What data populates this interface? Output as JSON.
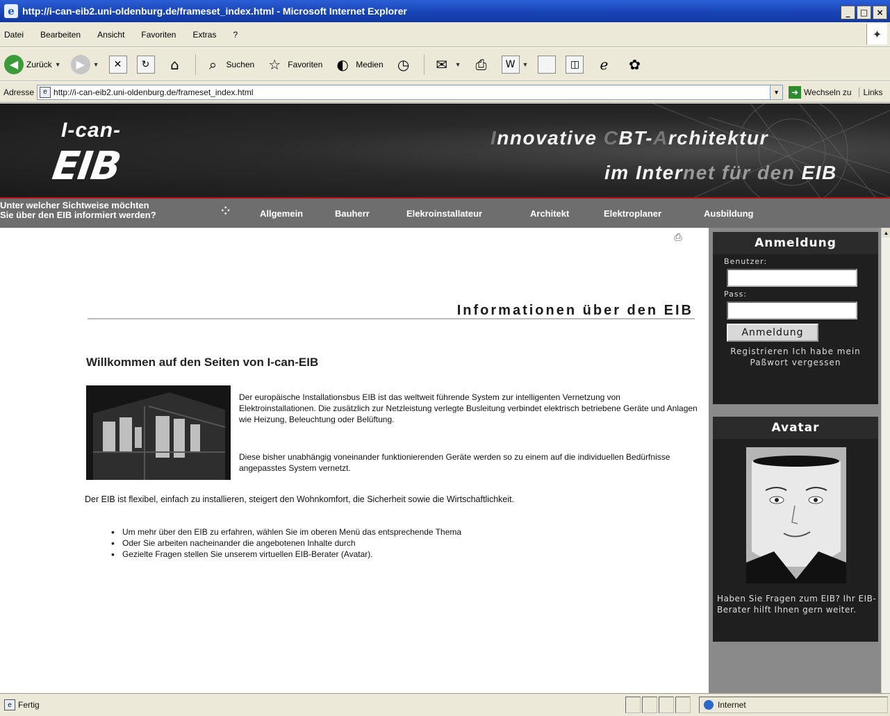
{
  "window": {
    "title": "http://i-can-eib2.uni-oldenburg.de/frameset_index.html - Microsoft Internet Explorer",
    "controls": [
      "_",
      "□",
      "×"
    ]
  },
  "menu": [
    "Datei",
    "Bearbeiten",
    "Ansicht",
    "Favoriten",
    "Extras",
    "?"
  ],
  "toolbar": {
    "back": "Zurück",
    "search": "Suchen",
    "favorites": "Favoriten",
    "media": "Medien"
  },
  "address": {
    "label": "Adresse",
    "url": "http://i-can-eib2.uni-oldenburg.de/frameset_index.html",
    "go": "Wechseln zu",
    "links": "Links"
  },
  "banner": {
    "logo_top": "I-can-",
    "logo_bottom": "EIB",
    "tagline1_dim_i": "I",
    "tagline1_a": "nnovative ",
    "tagline1_dim_c": "C",
    "tagline1_b": "BT-",
    "tagline1_dim_a": "A",
    "tagline1_c": "rchitektur",
    "tagline2_a": "im Inter",
    "tagline2_dim": "net für den ",
    "tagline2_b": "EIB"
  },
  "nav": {
    "question_line1": "Unter welcher Sichtweise möchten",
    "question_line2": "Sie über den EIB informiert werden?",
    "items": [
      "Allgemein",
      "Bauherr",
      "Elekroinstallateur",
      "Architekt",
      "Elektroplaner",
      "Ausbildung"
    ]
  },
  "content": {
    "heading": "Informationen über den EIB",
    "subheading": "Willkommen auf den Seiten von I-can-EIB",
    "paragraph1": "Der europäische Installationsbus EIB ist das weltweit führende System zur intelligenten Vernetzung von Elektroinstallationen. Die zusätzlich zur Netzleistung verlegte Busleitung verbindet elektrisch betriebene Geräte und Anlagen wie Heizung, Beleuchtung oder Belüftung.",
    "paragraph2": "Diese bisher unabhängig voneinander funktionierenden Geräte werden so zu einem auf die individuellen Bedürfnisse angepasstes System vernetzt.",
    "paragraph3": "Der EIB ist flexibel, einfach zu installieren, steigert den Wohnkomfort, die Sicherheit sowie die Wirtschaftlichkeit.",
    "bullets": [
      "Um mehr über den EIB zu erfahren, wählen Sie im oberen Menü das entsprechende Thema",
      "Oder Sie arbeiten nacheinander die angebotenen Inhalte durch",
      "Gezielte Fragen stellen Sie unserem virtuellen EIB-Berater (Avatar)."
    ]
  },
  "login": {
    "title": "Anmeldung",
    "user_label": "Benutzer:",
    "pass_label": "Pass:",
    "button": "Anmeldung",
    "register": "Registrieren Ich habe mein Paßwort vergessen"
  },
  "avatar": {
    "title": "Avatar",
    "question": "Haben Sie Fragen zum EIB? Ihr EIB-Berater hilft Ihnen gern weiter."
  },
  "status": {
    "text": "Fertig",
    "zone": "Internet"
  }
}
